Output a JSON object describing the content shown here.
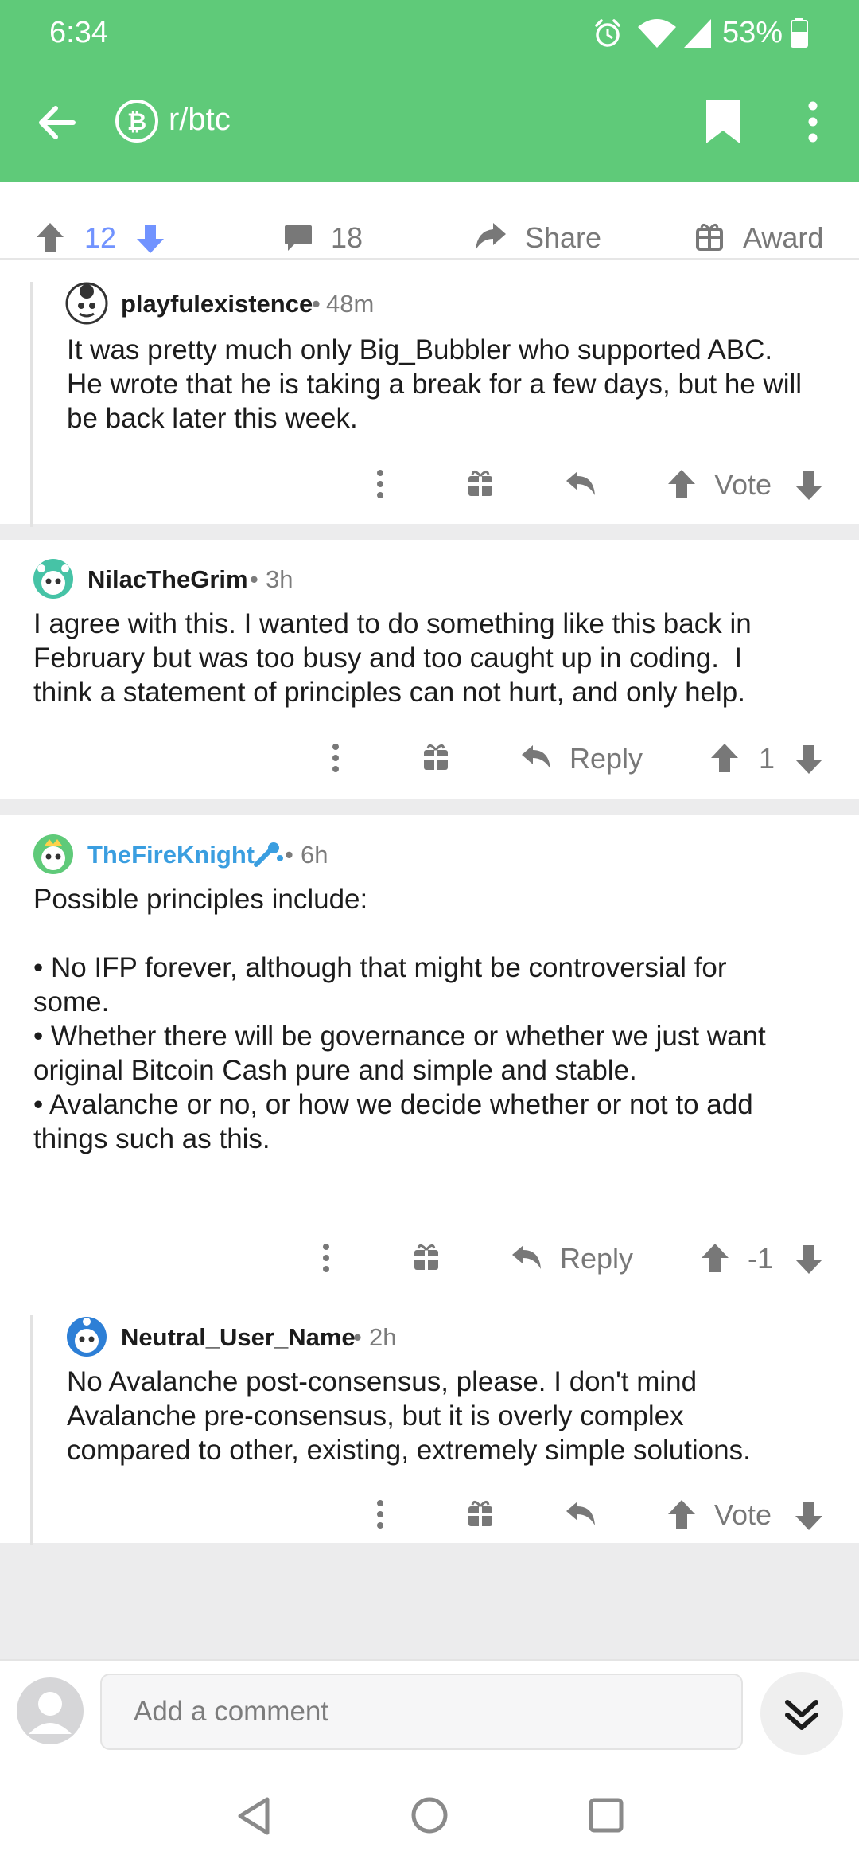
{
  "status_bar": {
    "time": "6:34",
    "battery": "53%"
  },
  "toolbar": {
    "subreddit": "r/btc"
  },
  "post_actions": {
    "upvotes": "12",
    "comments": "18",
    "share_label": "Share",
    "award_label": "Award"
  },
  "comments": [
    {
      "user": "playfulexistence",
      "age": "48m",
      "body": "It was pretty much only Big_Bubbler who supported ABC.\nHe wrote that he is taking a break for a few days, but he will\nbe back later this week.",
      "vote_label": "Vote"
    },
    {
      "user": "NilacTheGrim",
      "age": "3h",
      "body": "I agree with this. I wanted to do something like this back in\nFebruary but was too busy and too caught up in coding.  I\nthink a statement of principles can not hurt, and only help.",
      "reply_label": "Reply",
      "score": "1"
    },
    {
      "user": "TheFireKnight",
      "age": "6h",
      "body": "Possible principles include:\n\n• No IFP forever, although that might be controversial for\nsome.\n• Whether there will be governance or whether we just want\noriginal Bitcoin Cash pure and simple and stable.\n• Avalanche or no, or how we decide whether or not to add\nthings such as this.",
      "reply_label": "Reply",
      "score": "-1"
    },
    {
      "user": "Neutral_User_Name",
      "age": "2h",
      "body": "No Avalanche post-consensus, please. I don't mind\nAvalanche pre-consensus, but it is overly complex\ncompared to other, existing, extremely simple solutions.",
      "vote_label": "Vote"
    }
  ],
  "comment_box": {
    "placeholder": "Add a comment"
  },
  "colors": {
    "header": "#5fca79",
    "upvote_active": "#7193ff",
    "moderator": "#3a9ee0",
    "text": "#1c1c1c",
    "muted": "#787878"
  }
}
